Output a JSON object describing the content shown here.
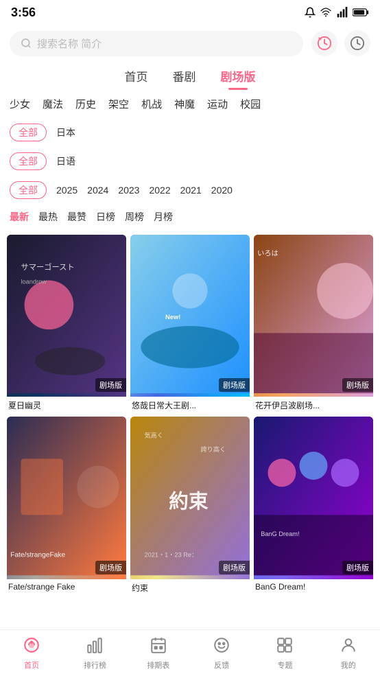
{
  "statusBar": {
    "time": "3:56",
    "icons": [
      "notification",
      "wifi",
      "signal",
      "battery"
    ]
  },
  "search": {
    "placeholder": "搜索名称 简介",
    "icon1": "history-circle",
    "icon2": "clock-history"
  },
  "mainTabs": [
    {
      "id": "home",
      "label": "首页",
      "active": false
    },
    {
      "id": "series",
      "label": "番剧",
      "active": false
    },
    {
      "id": "theater",
      "label": "剧场版",
      "active": true
    }
  ],
  "categories": [
    {
      "id": "girl",
      "label": "少女"
    },
    {
      "id": "magic",
      "label": "魔法"
    },
    {
      "id": "history",
      "label": "历史"
    },
    {
      "id": "scifi",
      "label": "架空"
    },
    {
      "id": "mecha",
      "label": "机战"
    },
    {
      "id": "fantasy",
      "label": "神魔"
    },
    {
      "id": "sports",
      "label": "运动"
    },
    {
      "id": "school",
      "label": "校园"
    }
  ],
  "filters": {
    "region": {
      "selected": "全部",
      "options": [
        "全部",
        "日本"
      ]
    },
    "language": {
      "selected": "全部",
      "options": [
        "全部",
        "日语"
      ]
    },
    "year": {
      "selected": "全部",
      "options": [
        "全部",
        "2025",
        "2024",
        "2023",
        "2022",
        "2021",
        "2020"
      ]
    },
    "sort": {
      "selected": "最新",
      "options": [
        "最新",
        "最热",
        "最赞",
        "日榜",
        "周榜",
        "月榜"
      ]
    }
  },
  "cards": [
    {
      "id": 1,
      "title": "夏日幽灵",
      "badge": "剧场版",
      "bgClass": "card-bg-1"
    },
    {
      "id": 2,
      "title": "悠哉日常大王剧...",
      "badge": "剧场版",
      "bgClass": "card-bg-2"
    },
    {
      "id": 3,
      "title": "花开伊吕波剧场...",
      "badge": "剧场版",
      "bgClass": "card-bg-3"
    },
    {
      "id": 4,
      "title": "Fate/strange Fake",
      "badge": "剧场版",
      "bgClass": "card-bg-4"
    },
    {
      "id": 5,
      "title": "约束",
      "badge": "剧场版",
      "bgClass": "card-bg-5"
    },
    {
      "id": 6,
      "title": "BanG Dream!",
      "badge": "剧场版",
      "bgClass": "card-bg-6"
    }
  ],
  "bottomNav": [
    {
      "id": "home",
      "icon": "🏠",
      "label": "首页",
      "active": true
    },
    {
      "id": "rank",
      "icon": "📊",
      "label": "排行榜",
      "active": false
    },
    {
      "id": "schedule",
      "icon": "📅",
      "label": "排期表",
      "active": false
    },
    {
      "id": "feedback",
      "icon": "😊",
      "label": "反馈",
      "active": false
    },
    {
      "id": "topics",
      "icon": "🎯",
      "label": "专题",
      "active": false
    },
    {
      "id": "mine",
      "icon": "👤",
      "label": "我的",
      "active": false
    }
  ]
}
